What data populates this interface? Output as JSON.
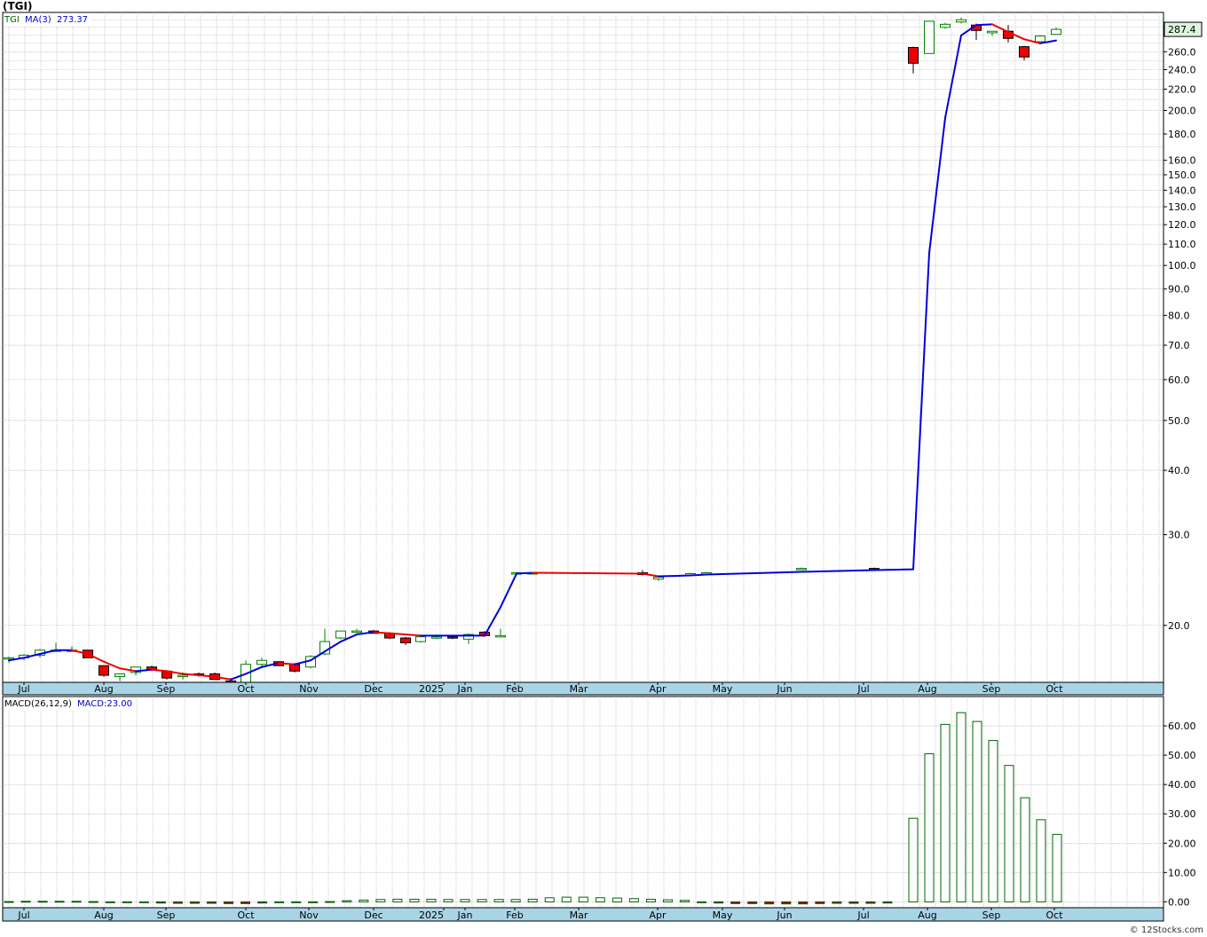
{
  "title": "(TGI)",
  "copyright": "© 12Stocks.com",
  "colors": {
    "up_candle_fill": "#ffffff",
    "up_candle_stroke": "#008000",
    "down_candle_fill": "#ee0000",
    "ma_rising": "#0000dd",
    "ma_falling": "#ee0000",
    "histogram": "#006600",
    "axis_band": "#a8d4e6",
    "grid": "#aaaaaa",
    "last_price_box": "#ddf5dd"
  },
  "price_panel": {
    "legend": {
      "ticker": "TGI",
      "ma_label": "MA(3)",
      "ma_value": "273.37"
    },
    "last_price": "287.4",
    "y_ticks": [
      "260.0",
      "240.0",
      "220.0",
      "200.0",
      "180.0",
      "160.0",
      "150.0",
      "140.0",
      "130.0",
      "120.0",
      "110.0",
      "100.0",
      "90.0",
      "80.0",
      "70.0",
      "60.0",
      "50.0",
      "40.0",
      "30.0",
      "20.0"
    ]
  },
  "macd_panel": {
    "legend": {
      "label": "MACD(26,12,9)",
      "value": "MACD:23.00"
    },
    "y_ticks": [
      "60.00",
      "50.00",
      "40.00",
      "30.00",
      "20.00",
      "10.00",
      "0.00"
    ]
  },
  "x_axis_labels": [
    "Jul",
    "Aug",
    "Sep",
    "Oct",
    "Nov",
    "Dec",
    "2025",
    "Jan",
    "Feb",
    "Mar",
    "Apr",
    "May",
    "Jun",
    "Jul",
    "Aug",
    "Sep",
    "Oct"
  ],
  "chart_data": {
    "type": "candlestick",
    "scale": "log",
    "ylim": [
      15.5,
      300
    ],
    "x_labels": [
      "Jul",
      "Aug",
      "Sep",
      "Oct",
      "Nov",
      "Dec",
      "2025",
      "Jan",
      "Feb",
      "Mar",
      "Apr",
      "May",
      "Jun",
      "Jul",
      "Aug",
      "Sep",
      "Oct"
    ],
    "candles": [
      {
        "o": 17.2,
        "h": 17.4,
        "l": 16.9,
        "c": 17.3
      },
      {
        "o": 17.3,
        "h": 17.6,
        "l": 17.1,
        "c": 17.5
      },
      {
        "o": 17.5,
        "h": 18.0,
        "l": 17.3,
        "c": 17.9
      },
      {
        "o": 17.8,
        "h": 18.5,
        "l": 17.8,
        "c": 17.9
      },
      {
        "o": 17.9,
        "h": 18.2,
        "l": 17.8,
        "c": 17.9
      },
      {
        "o": 17.9,
        "h": 17.9,
        "l": 17.3,
        "c": 17.3
      },
      {
        "o": 16.7,
        "h": 16.7,
        "l": 15.9,
        "c": 16.0
      },
      {
        "o": 15.9,
        "h": 16.1,
        "l": 15.6,
        "c": 16.1
      },
      {
        "o": 16.2,
        "h": 16.6,
        "l": 16.0,
        "c": 16.6
      },
      {
        "o": 16.6,
        "h": 16.7,
        "l": 16.3,
        "c": 16.4
      },
      {
        "o": 16.3,
        "h": 16.3,
        "l": 15.7,
        "c": 15.8
      },
      {
        "o": 15.9,
        "h": 16.2,
        "l": 15.7,
        "c": 16.0
      },
      {
        "o": 16.1,
        "h": 16.2,
        "l": 15.9,
        "c": 16.0
      },
      {
        "o": 16.1,
        "h": 16.2,
        "l": 15.7,
        "c": 15.7
      },
      {
        "o": 15.6,
        "h": 15.8,
        "l": 15.4,
        "c": 15.5
      },
      {
        "o": 15.5,
        "h": 17.1,
        "l": 15.1,
        "c": 16.8
      },
      {
        "o": 16.8,
        "h": 17.3,
        "l": 16.6,
        "c": 17.1
      },
      {
        "o": 17.0,
        "h": 17.0,
        "l": 16.7,
        "c": 16.7
      },
      {
        "o": 16.8,
        "h": 16.9,
        "l": 16.2,
        "c": 16.3
      },
      {
        "o": 16.6,
        "h": 17.5,
        "l": 16.5,
        "c": 17.4
      },
      {
        "o": 17.6,
        "h": 19.7,
        "l": 17.5,
        "c": 18.6
      },
      {
        "o": 18.9,
        "h": 19.5,
        "l": 18.8,
        "c": 19.5
      },
      {
        "o": 19.5,
        "h": 19.7,
        "l": 19.3,
        "c": 19.5
      },
      {
        "o": 19.5,
        "h": 19.6,
        "l": 19.3,
        "c": 19.3
      },
      {
        "o": 19.3,
        "h": 19.4,
        "l": 18.8,
        "c": 18.9
      },
      {
        "o": 18.9,
        "h": 19.0,
        "l": 18.3,
        "c": 18.5
      },
      {
        "o": 18.6,
        "h": 19.1,
        "l": 18.5,
        "c": 19.0
      },
      {
        "o": 19.0,
        "h": 19.1,
        "l": 18.8,
        "c": 19.0
      },
      {
        "o": 19.0,
        "h": 19.1,
        "l": 18.8,
        "c": 18.9
      },
      {
        "o": 18.8,
        "h": 19.3,
        "l": 18.4,
        "c": 19.2
      },
      {
        "o": 19.4,
        "h": 19.5,
        "l": 19.0,
        "c": 19.1
      },
      {
        "o": 19.1,
        "h": 19.7,
        "l": 19.0,
        "c": 19.1
      },
      {
        "o": 25.2,
        "h": 25.4,
        "l": 25.1,
        "c": 25.3
      },
      {
        "o": 25.2,
        "h": 25.4,
        "l": 25.2,
        "c": 25.3
      },
      {
        "o": 25.3,
        "h": 25.6,
        "l": 25.0,
        "c": 25.1
      },
      {
        "o": 24.6,
        "h": 24.9,
        "l": 24.4,
        "c": 24.8
      },
      {
        "o": 25.0,
        "h": 25.3,
        "l": 24.9,
        "c": 25.2
      },
      {
        "o": 25.2,
        "h": 25.4,
        "l": 25.1,
        "c": 25.3
      },
      {
        "o": 25.7,
        "h": 25.9,
        "l": 25.6,
        "c": 25.8
      },
      {
        "o": 25.8,
        "h": 25.9,
        "l": 25.6,
        "c": 25.7
      },
      {
        "o": 265,
        "h": 266,
        "l": 236,
        "c": 247
      },
      {
        "o": 258,
        "h": 298,
        "l": 258,
        "c": 298
      },
      {
        "o": 290,
        "h": 296,
        "l": 288,
        "c": 294
      },
      {
        "o": 297,
        "h": 303,
        "l": 295,
        "c": 300
      },
      {
        "o": 293,
        "h": 295,
        "l": 274,
        "c": 286
      },
      {
        "o": 283,
        "h": 285,
        "l": 279,
        "c": 285
      },
      {
        "o": 285,
        "h": 293,
        "l": 271,
        "c": 276
      },
      {
        "o": 266,
        "h": 267,
        "l": 250,
        "c": 254
      },
      {
        "o": 272,
        "h": 280,
        "l": 272,
        "c": 279
      },
      {
        "o": 281,
        "h": 290,
        "l": 281,
        "c": 287.4
      }
    ],
    "ma3": [
      17.1,
      17.3,
      17.6,
      17.9,
      17.9,
      17.6,
      17.0,
      16.5,
      16.3,
      16.4,
      16.3,
      16.1,
      16.0,
      15.9,
      15.7,
      16.1,
      16.6,
      16.9,
      16.8,
      17.1,
      17.8,
      18.6,
      19.2,
      19.4,
      19.3,
      19.2,
      19.1,
      19.1,
      19.1,
      19.1,
      19.1,
      21.7,
      25.2,
      25.3,
      25.2,
      24.9,
      25.0,
      25.1,
      25.4,
      25.6,
      25.7,
      105.7,
      193.5,
      279.7,
      293.0,
      294.0,
      284.0,
      275.0,
      270.0,
      273.4
    ],
    "macd": [
      0.1,
      0.2,
      0.2,
      0.2,
      0.2,
      0.1,
      -0.1,
      -0.3,
      -0.3,
      -0.4,
      -0.5,
      -0.5,
      -0.5,
      -0.6,
      -0.6,
      -0.4,
      -0.2,
      -0.1,
      -0.1,
      0.1,
      0.4,
      0.6,
      0.8,
      0.9,
      0.9,
      0.9,
      0.8,
      0.8,
      0.8,
      0.8,
      0.8,
      0.9,
      1.4,
      1.6,
      1.6,
      1.4,
      1.3,
      1.1,
      0.9,
      0.7,
      0.5,
      -0.1,
      -0.4,
      -0.6,
      -0.6,
      -0.7,
      -0.7,
      -0.7,
      -0.6,
      -0.5,
      -0.5,
      -0.5,
      -0.4,
      28.5,
      50.5,
      60.5,
      64.5,
      61.5,
      55.0,
      46.5,
      35.5,
      28.0,
      23.0
    ]
  }
}
